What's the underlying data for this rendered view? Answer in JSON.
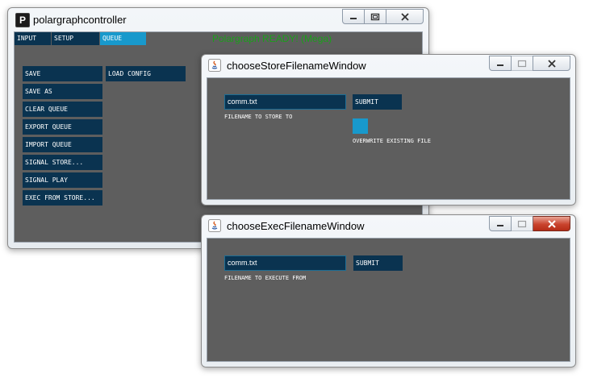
{
  "main_window": {
    "title": "polargraphcontroller",
    "app_icon_letter": "P",
    "tabs": [
      {
        "label": "INPUT",
        "active": false
      },
      {
        "label": "SETUP",
        "active": false
      },
      {
        "label": "QUEUE",
        "active": true
      }
    ],
    "status": "Polargraph READY! (Mega)",
    "buttons": [
      "SAVE",
      "SAVE AS",
      "CLEAR QUEUE",
      "EXPORT QUEUE",
      "IMPORT QUEUE",
      "SIGNAL STORE...",
      "SIGNAL PLAY",
      "EXEC FROM STORE..."
    ],
    "load_config": "LOAD CONFIG"
  },
  "store_window": {
    "title": "chooseStoreFilenameWindow",
    "filename_value": "comm.txt",
    "filename_label": "FILENAME TO STORE TO",
    "submit_label": "SUBMIT",
    "overwrite_label": "OVERWRITE EXISTING FILE",
    "overwrite_checked": true
  },
  "exec_window": {
    "title": "chooseExecFilenameWindow",
    "filename_value": "comm.txt",
    "filename_label": "FILENAME TO EXECUTE FROM",
    "submit_label": "SUBMIT"
  },
  "colors": {
    "client_bg": "#5e5e5e",
    "button_bg": "#0a3350",
    "tab_active": "#1899cc",
    "status_green": "#1aa01a"
  },
  "icons": [
    "app-icon",
    "java-icon",
    "minimize-icon",
    "maximize-icon",
    "close-icon"
  ]
}
